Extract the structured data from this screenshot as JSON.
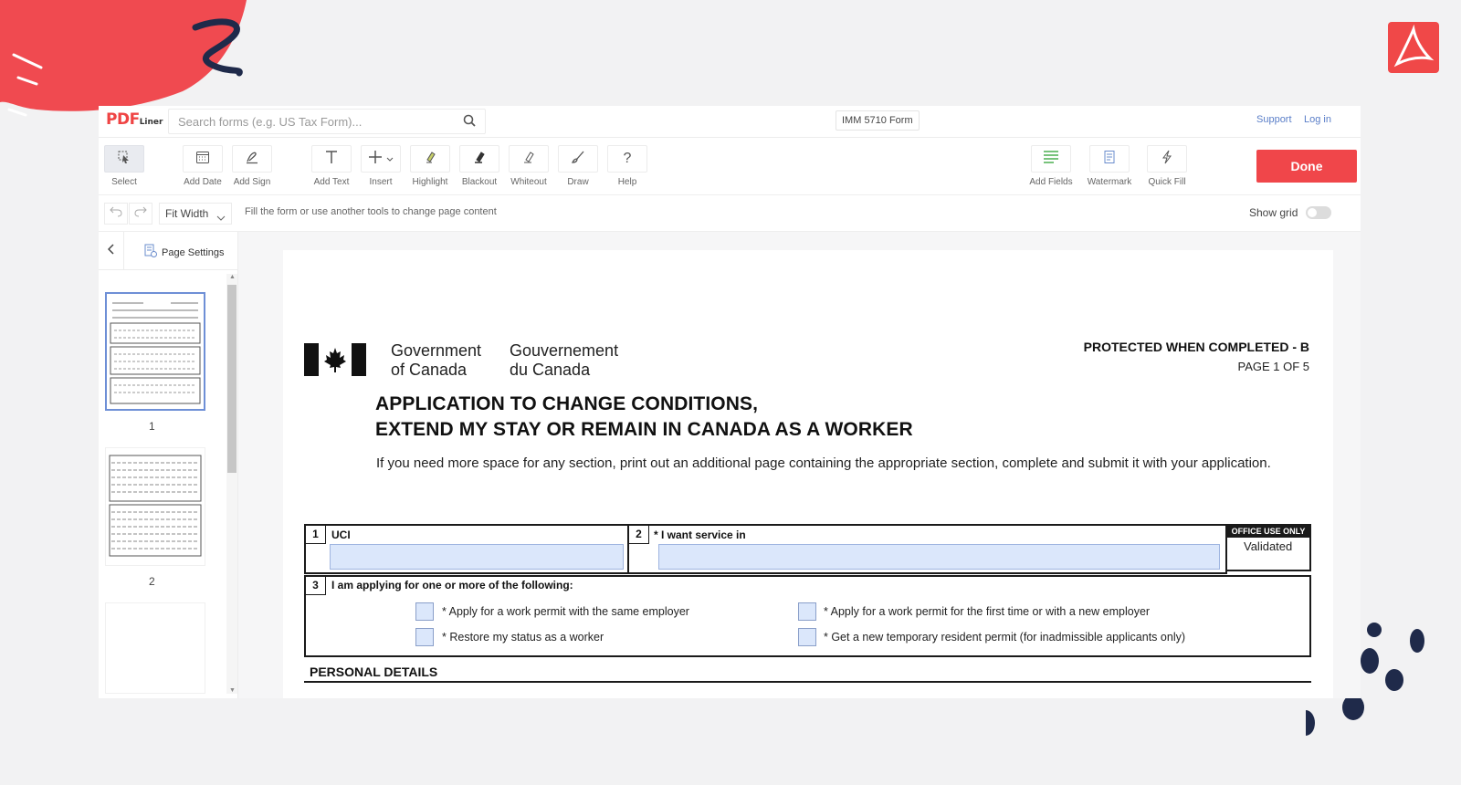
{
  "app": {
    "brand": "PDF",
    "brand_sub": "Liner",
    "search_placeholder": "Search forms (e.g. US Tax Form)...",
    "form_name": "IMM 5710 Form",
    "links": {
      "support": "Support",
      "login": "Log in"
    }
  },
  "toolbar": {
    "select": "Select",
    "add_date": "Add Date",
    "add_sign": "Add Sign",
    "add_text": "Add Text",
    "insert": "Insert",
    "highlight": "Highlight",
    "blackout": "Blackout",
    "whiteout": "Whiteout",
    "draw": "Draw",
    "help": "Help",
    "add_fields": "Add Fields",
    "watermark": "Watermark",
    "quick_fill": "Quick Fill",
    "done": "Done"
  },
  "subbar": {
    "zoom": "Fit Width",
    "hint": "Fill the form or use another tools to change page content",
    "show_grid": "Show grid"
  },
  "sidebar": {
    "page_settings": "Page Settings",
    "pages": [
      "1",
      "2"
    ]
  },
  "document": {
    "gov_en_line1": "Government",
    "gov_en_line2": "of Canada",
    "gov_fr_line1": "Gouvernement",
    "gov_fr_line2": "du Canada",
    "protected": "PROTECTED WHEN COMPLETED - B",
    "page_of": "PAGE 1 OF 5",
    "title_line1": "APPLICATION TO CHANGE CONDITIONS,",
    "title_line2": "EXTEND MY STAY OR REMAIN IN CANADA AS A WORKER",
    "intro": "If you need more space for any section, print out an additional page containing the appropriate section, complete and submit it with your application.",
    "field1_num": "1",
    "field1_label": "UCI",
    "field2_num": "2",
    "field2_label": "* I want service in",
    "office_use": "OFFICE USE ONLY",
    "validated": "Validated",
    "field3_num": "3",
    "field3_label": "I am applying for one or more of the following:",
    "options": [
      "* Apply for a work permit with the same employer",
      "*  Restore my status as a worker",
      "* Apply for a work permit for the first time or with a new employer",
      "* Get a new temporary resident permit (for inadmissible applicants only)"
    ],
    "personal_details": "PERSONAL DETAILS"
  },
  "colors": {
    "accent": "#f0464a",
    "link": "#5a7ec8",
    "field_fill": "#dbe7fb"
  }
}
